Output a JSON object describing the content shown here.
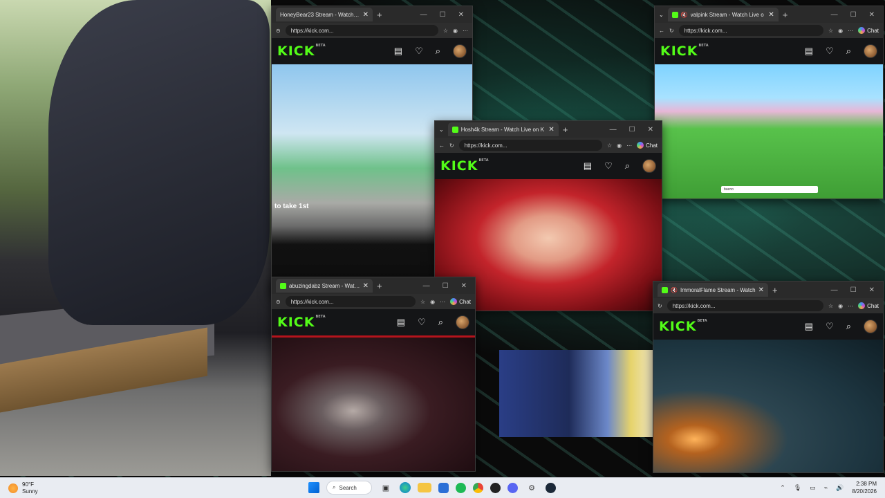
{
  "windows": {
    "honeybear": {
      "tab_title": "HoneyBear23 Stream - Watch Live",
      "url": "https://kick.com...",
      "video_caption": "to take 1st"
    },
    "valpink": {
      "tab_title": "valpink Stream - Watch Live o",
      "url": "https://kick.com...",
      "chat_label": "Chat",
      "chat_input": "bueno"
    },
    "hosh4k": {
      "tab_title": "Hosh4k Stream - Watch Live on K",
      "url": "https://kick.com...",
      "chat_label": "Chat"
    },
    "abuzingdabz": {
      "tab_title": "abuzingdabz Stream - Watch Live",
      "url": "https://kick.com...",
      "chat_label": "Chat"
    },
    "immoralflame": {
      "tab_title": "ImmoralFlame Stream - Watch",
      "url": "https://kick.com...",
      "chat_label": "Chat"
    }
  },
  "kick": {
    "logo": "KICK",
    "beta": "BETA"
  },
  "icons": {
    "favicon": "kick-favicon",
    "close": "close-icon",
    "new_tab": "plus-icon",
    "minimize": "minimize-icon",
    "maximize": "maximize-icon",
    "back": "back-arrow-icon",
    "reload": "reload-icon",
    "mute": "mute-icon"
  },
  "taskbar": {
    "weather_temp": "90°F",
    "weather_cond": "Sunny",
    "search_label": "Search",
    "time": "2:38 PM",
    "date": "8/20/2026"
  },
  "colors": {
    "kick_green": "#53fc18",
    "window_bg": "#1f1f1f",
    "taskbar_bg": "#e9ecf2"
  }
}
